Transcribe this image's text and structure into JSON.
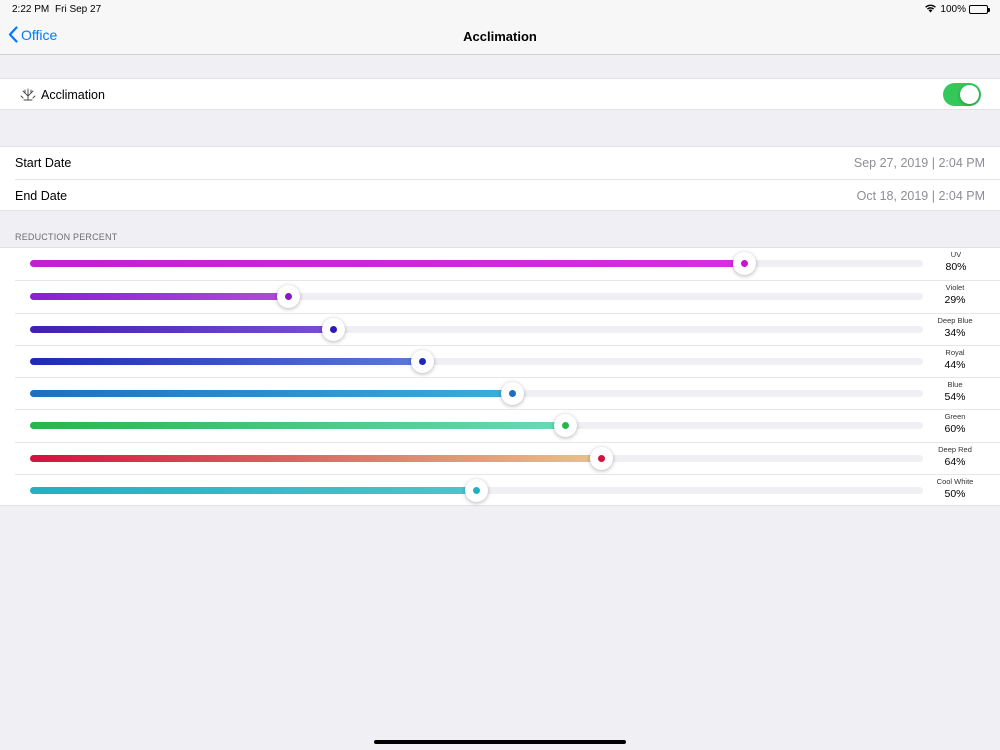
{
  "status": {
    "time": "2:22 PM",
    "date": "Fri Sep 27",
    "battery": "100%"
  },
  "nav": {
    "back_label": "Office",
    "title": "Acclimation"
  },
  "acclimation": {
    "label": "Acclimation",
    "enabled": true,
    "icon": "coral-icon"
  },
  "dates": {
    "start_label": "Start Date",
    "start_value": "Sep 27, 2019 | 2:04 PM",
    "end_label": "End Date",
    "end_value": "Oct 18, 2019 | 2:04 PM"
  },
  "reduction": {
    "header": "REDUCTION PERCENT",
    "channels": [
      {
        "name": "UV",
        "pct": "80%",
        "value": 80,
        "start": "#c21fcf",
        "end": "#d92de0",
        "dot": "#c516c9"
      },
      {
        "name": "Violet",
        "pct": "29%",
        "value": 29,
        "start": "#8a1fd4",
        "end": "#b44ad9",
        "dot": "#8a17c6"
      },
      {
        "name": "Deep Blue",
        "pct": "34%",
        "value": 34,
        "start": "#3f1fb5",
        "end": "#7a4fd6",
        "dot": "#3019b0"
      },
      {
        "name": "Royal",
        "pct": "44%",
        "value": 44,
        "start": "#1d2ab8",
        "end": "#5a7ad8",
        "dot": "#1d2ab8"
      },
      {
        "name": "Blue",
        "pct": "54%",
        "value": 54,
        "start": "#1f6fc0",
        "end": "#3aaed8",
        "dot": "#1f6fc0"
      },
      {
        "name": "Green",
        "pct": "60%",
        "value": 60,
        "start": "#28b64a",
        "end": "#6ad9b8",
        "dot": "#28b64a"
      },
      {
        "name": "Deep Red",
        "pct": "64%",
        "value": 64,
        "start": "#d2123e",
        "end": "#e6c48e",
        "dot": "#d2123e"
      },
      {
        "name": "Cool White",
        "pct": "50%",
        "value": 50,
        "start": "#1fb2bd",
        "end": "#4cc5cc",
        "dot": "#1fb2bd"
      }
    ]
  }
}
